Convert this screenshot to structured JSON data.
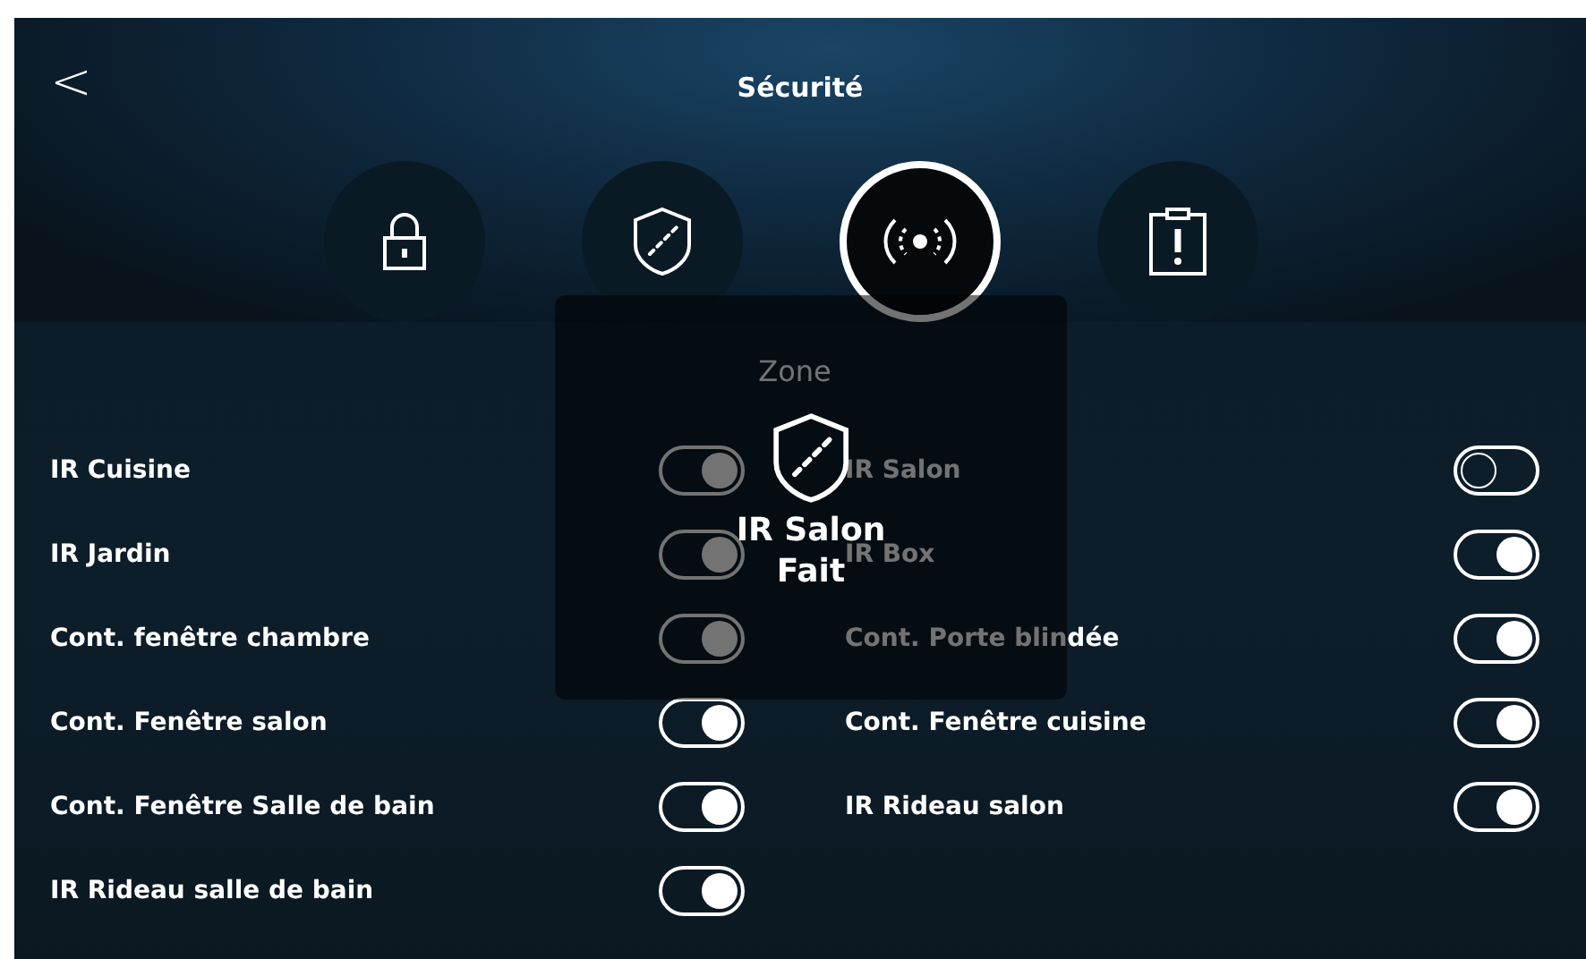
{
  "header": {
    "back": "<",
    "title": "Sécurité"
  },
  "tabs": [
    {
      "kind": "lock",
      "selected": false
    },
    {
      "kind": "shield",
      "selected": false
    },
    {
      "kind": "signal",
      "selected": true
    },
    {
      "kind": "alert",
      "selected": false
    }
  ],
  "zone_heading": "Zone",
  "left_column": [
    {
      "label": "IR Cuisine",
      "on": true
    },
    {
      "label": "IR Jardin",
      "on": true
    },
    {
      "label": "Cont. fenêtre chambre",
      "on": true
    },
    {
      "label": "Cont. Fenêtre salon",
      "on": true
    },
    {
      "label": "Cont. Fenêtre Salle de bain",
      "on": true
    },
    {
      "label": "IR Rideau salle de bain",
      "on": true
    }
  ],
  "right_column": [
    {
      "label": "IR Salon",
      "on": false
    },
    {
      "label": "IR Box",
      "on": true
    },
    {
      "label": "Cont. Porte blindée",
      "on": true
    },
    {
      "label": "Cont. Fenêtre cuisine",
      "on": true
    },
    {
      "label": "IR Rideau salon",
      "on": true
    }
  ],
  "toast": {
    "title": "IR Salon",
    "status": "Fait"
  }
}
